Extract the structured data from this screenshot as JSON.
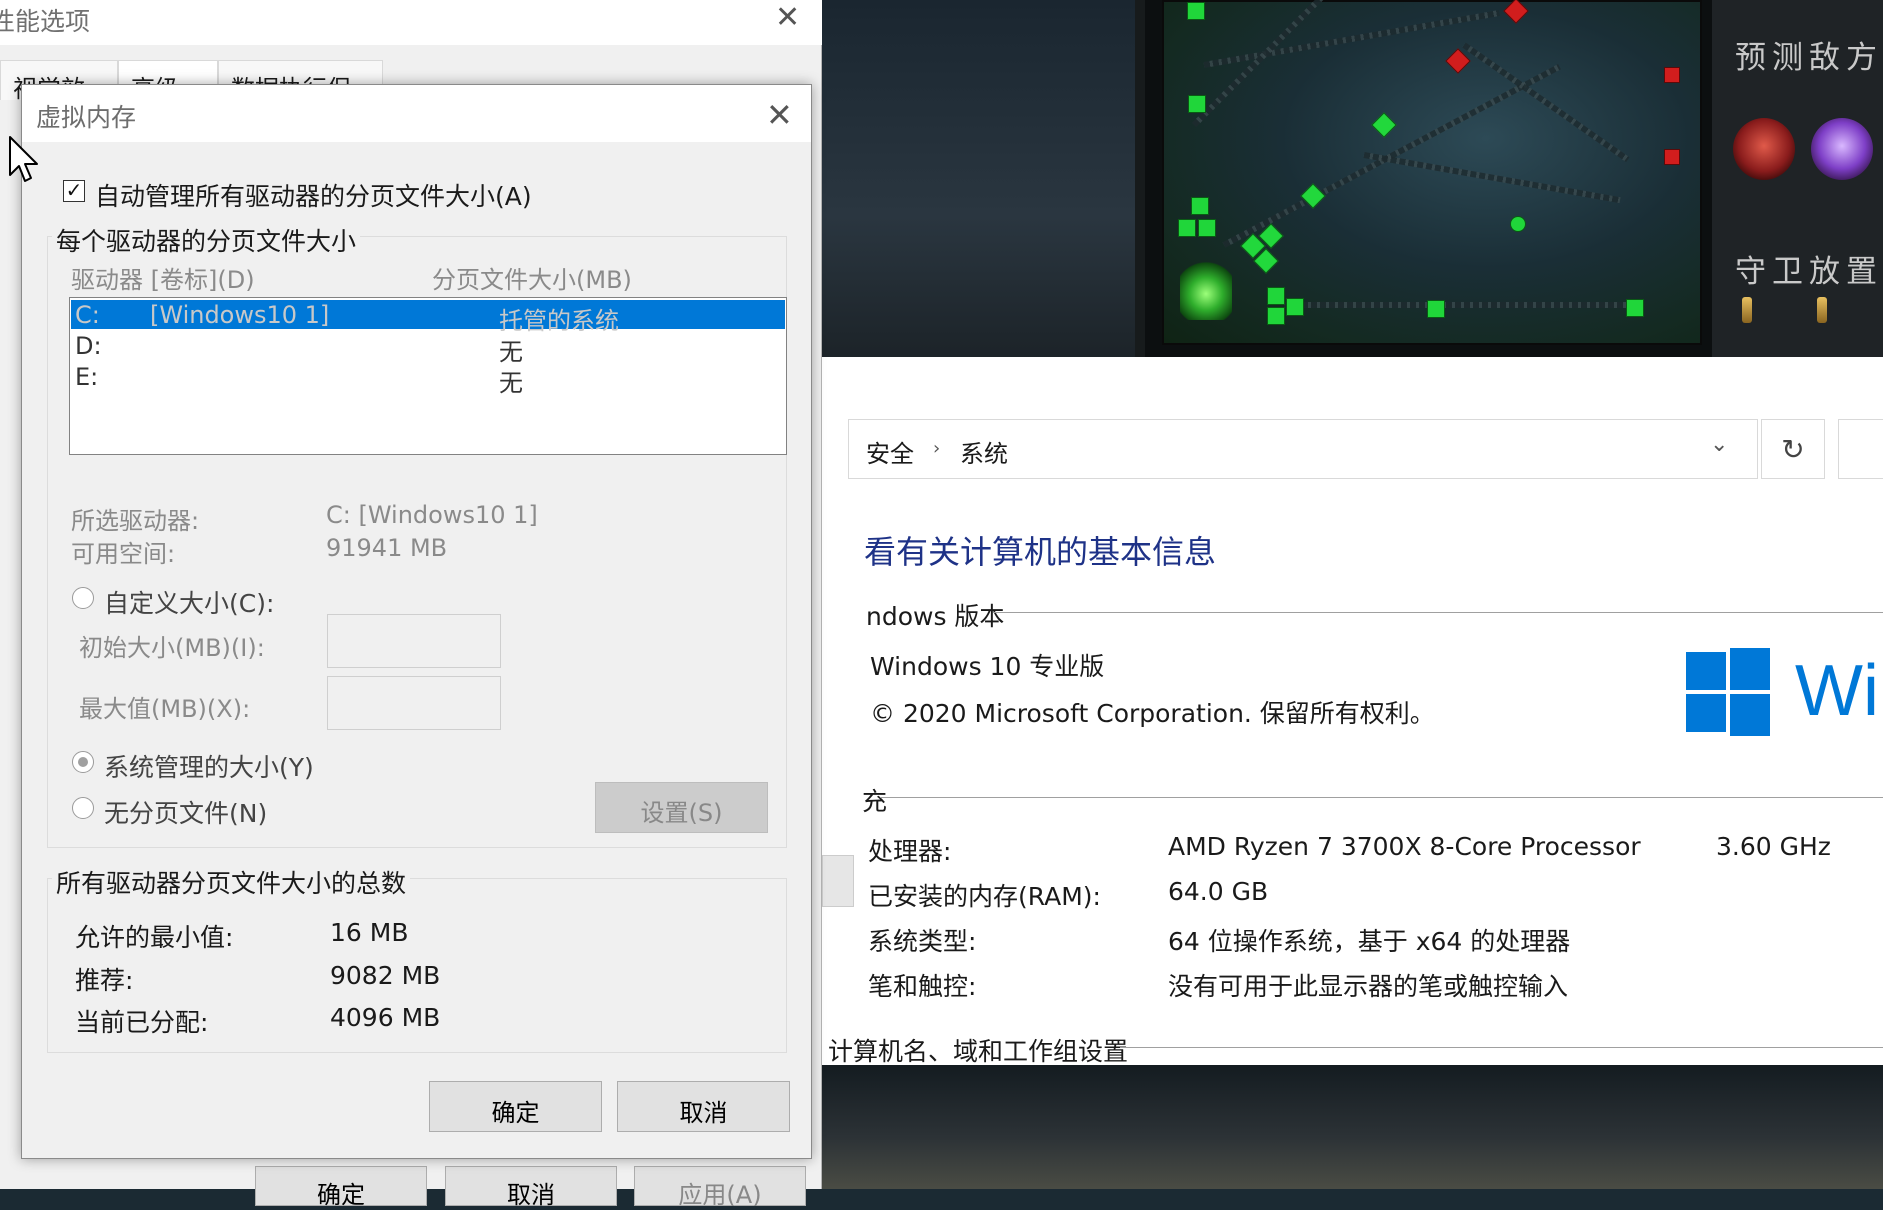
{
  "game": {
    "predict_label": "预测敌方",
    "wards_label": "守卫放置"
  },
  "system_window": {
    "breadcrumb": [
      "安全",
      "系统"
    ],
    "heading": "看有关计算机的基本信息",
    "windows_section": "ndows 版本",
    "edition": "Windows 10 专业版",
    "copyright": "© 2020 Microsoft Corporation. 保留所有权利。",
    "logo_text": "Wi",
    "system_section": "充",
    "rows": [
      {
        "label": "处理器:",
        "value": "AMD Ryzen 7 3700X 8-Core Processor",
        "extra": "3.60 GHz"
      },
      {
        "label": "已安装的内存(RAM):",
        "value": "64.0 GB",
        "extra": ""
      },
      {
        "label": "系统类型:",
        "value": "64 位操作系统，基于 x64 的处理器",
        "extra": ""
      },
      {
        "label": "笔和触控:",
        "value": "没有可用于此显示器的笔或触控输入",
        "extra": ""
      }
    ],
    "computer_section": "计算机名、域和工作组设置",
    "colors": {
      "heading": "#1e3287",
      "logo": "#0078d7"
    }
  },
  "perf_dialog": {
    "title": "性能选项",
    "tabs": [
      "视觉效果",
      "高级",
      "数据执行保护"
    ],
    "buttons": [
      "确定",
      "取消",
      "应用(A)"
    ]
  },
  "vm_dialog": {
    "title": "虚拟内存",
    "auto_manage_label": "自动管理所有驱动器的分页文件大小(A)",
    "auto_manage_checked": true,
    "per_drive_group": "每个驱动器的分页文件大小",
    "col_drive": "驱动器 [卷标](D)",
    "col_size": "分页文件大小(MB)",
    "drives": [
      {
        "drive": "C:",
        "label": "[Windows10 1]",
        "size": "托管的系统",
        "selected": true
      },
      {
        "drive": "D:",
        "label": "",
        "size": "无",
        "selected": false
      },
      {
        "drive": "E:",
        "label": "",
        "size": "无",
        "selected": false
      }
    ],
    "selected_drive_label": "所选驱动器:",
    "selected_drive_value": "C:  [Windows10 1]",
    "free_space_label": "可用空间:",
    "free_space_value": "91941 MB",
    "custom_size": "自定义大小(C):",
    "initial_size": "初始大小(MB)(I):",
    "max_size": "最大值(MB)(X):",
    "system_managed": "系统管理的大小(Y)",
    "no_paging": "无分页文件(N)",
    "set_button": "设置(S)",
    "totals_group": "所有驱动器分页文件大小的总数",
    "min_label": "允许的最小值:",
    "min_value": "16 MB",
    "recommended_label": "推荐:",
    "recommended_value": "9082 MB",
    "allocated_label": "当前已分配:",
    "allocated_value": "4096 MB",
    "ok_button": "确定",
    "cancel_button": "取消",
    "selection_color": "#0078d7"
  }
}
